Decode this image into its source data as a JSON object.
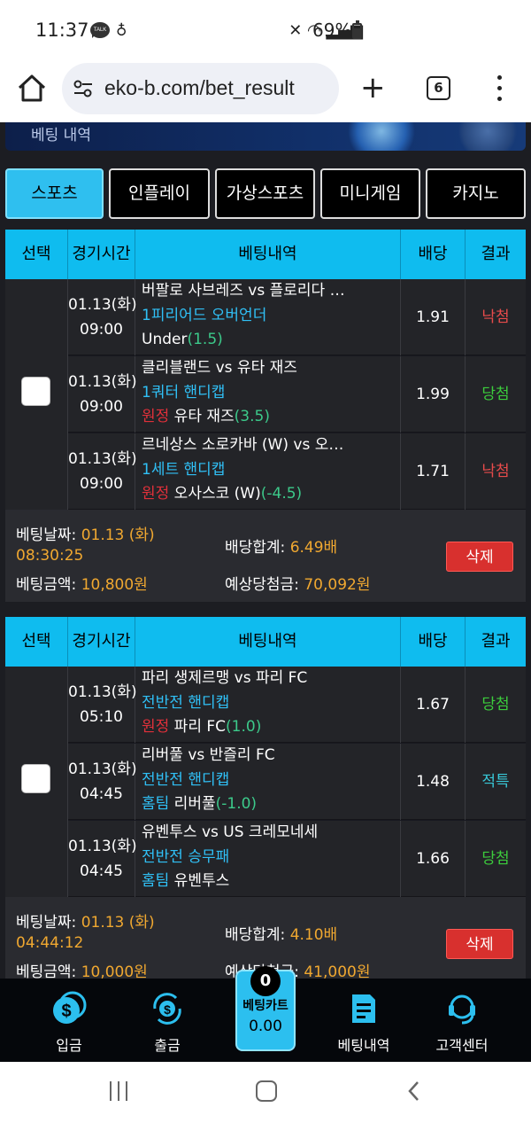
{
  "status_bar": {
    "time": "11:37",
    "kakao": "TALK",
    "battery": "69%"
  },
  "browser": {
    "url": "eko-b.com/bet_result",
    "tab_count": "6"
  },
  "banner": {
    "title": "베팅 내역"
  },
  "category_tabs": [
    "스포츠",
    "인플레이",
    "가상스포츠",
    "미니게임",
    "카지노"
  ],
  "table_headers": {
    "select": "선택",
    "time": "경기시간",
    "detail": "베팅내역",
    "odds": "배당",
    "result": "결과"
  },
  "bets": [
    {
      "rows": [
        {
          "date": "01.13(화)",
          "time": "09:00",
          "match": "버팔로 사브레즈 vs 플로리다 …",
          "market": "1피리어드 오버언더",
          "pick_side": "",
          "pick": "Under",
          "line": "(1.5)",
          "odds": "1.91",
          "result": "낙첨"
        },
        {
          "date": "01.13(화)",
          "time": "09:00",
          "match": "클리블랜드 vs 유타 재즈",
          "market": "1쿼터 핸디캡",
          "pick_side": "원정",
          "pick": " 유타 재즈",
          "line": "(3.5)",
          "odds": "1.99",
          "result": "당첨"
        },
        {
          "date": "01.13(화)",
          "time": "09:00",
          "match": "르네상스 소로카바 (W) vs 오…",
          "market": "1세트 핸디캡",
          "pick_side": "원정",
          "pick": " 오사스코 (W)",
          "line": "(-4.5)",
          "odds": "1.71",
          "result": "낙첨"
        }
      ],
      "summary": {
        "date_label": "베팅날짜: ",
        "date_value": "01.13 (화)",
        "time_value": "08:30:25",
        "amount_label": "베팅금액: ",
        "amount_value": "10,800원",
        "total_odds_label": "배당합계: ",
        "total_odds_value": "6.49배",
        "expected_label": "예상당첨금: ",
        "expected_value": "70,092원",
        "delete_label": "삭제"
      }
    },
    {
      "rows": [
        {
          "date": "01.13(화)",
          "time": "05:10",
          "match": "파리 생제르맹 vs 파리 FC",
          "market": "전반전 핸디캡",
          "pick_side": "원정",
          "pick": " 파리 FC",
          "line": "(1.0)",
          "odds": "1.67",
          "result": "당첨"
        },
        {
          "date": "01.13(화)",
          "time": "04:45",
          "match": "리버풀 vs 반즐리 FC",
          "market": "전반전 핸디캡",
          "pick_side": "홈팀",
          "pick": " 리버풀",
          "line": "(-1.0)",
          "odds": "1.48",
          "result": "적특"
        },
        {
          "date": "01.13(화)",
          "time": "04:45",
          "match": "유벤투스 vs US 크레모네세",
          "market": "전반전 승무패",
          "pick_side": "홈팀",
          "pick": " 유벤투스",
          "line": "",
          "odds": "1.66",
          "result": "당첨"
        }
      ],
      "summary": {
        "date_label": "베팅날짜: ",
        "date_value": "01.13 (화)",
        "time_value": "04:44:12",
        "amount_label": "베팅금액: ",
        "amount_value": "10,000원",
        "total_odds_label": "배당합계: ",
        "total_odds_value": "4.10배",
        "expected_label": "예상당첨금: ",
        "expected_value": "41,000원",
        "delete_label": "삭제"
      }
    }
  ],
  "bottom_nav": {
    "deposit": "입금",
    "withdraw": "출금",
    "cart_label": "베팅카트",
    "cart_value": "0.00",
    "cart_count": "0",
    "history": "베팅내역",
    "support": "고객센터"
  },
  "colors": {
    "accent": "#2fbfef",
    "delete": "#d8302e",
    "win": "#3ccc3c",
    "lose": "#e84b4b",
    "refund": "#38c8d8",
    "highlight": "#f0a830"
  }
}
